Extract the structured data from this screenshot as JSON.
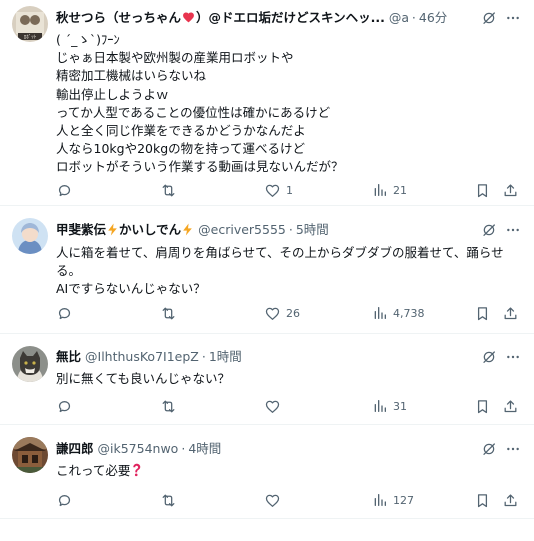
{
  "colors": {
    "text_primary": "#0f1419",
    "text_secondary": "#536471",
    "divider": "#eff3f4",
    "background": "#ffffff"
  },
  "tweets": [
    {
      "display_name": "秋せつら（せっちゃん",
      "display_name_after": "）@ドエロ垢だけどスキンヘッ...",
      "name_emoji": "heart",
      "handle": "@a",
      "time": "46分",
      "avatar_badge": "ﾛﾎﾞｯﾄ",
      "header_icon": "grok-icon",
      "more_icon": "more-icon",
      "body_lines": [
        "( ´_ゝ`)ﾌｰﾝ",
        "じゃぁ日本製や欧州製の産業用ロボットや",
        "精密加工機械はいらないね",
        "輸出停止しようよｗ",
        "ってか人型であることの優位性は確かにあるけど",
        "人と全く同じ作業をできるかどうかなんだよ",
        "人なら10kgや20kgの物を持って運べるけど",
        "ロボットがそういう作業する動画は見ないんだが？"
      ],
      "actions": {
        "reply": "",
        "repost": "",
        "like": "1",
        "views": "21"
      }
    },
    {
      "display_name": "甲斐紫伝",
      "display_name_mid": "かいしでん",
      "name_emoji": "lightning",
      "handle": "@ecriver5555",
      "time": "5時間",
      "header_icon": "grok-icon",
      "more_icon": "more-icon",
      "body_lines": [
        "人に箱を着せて、肩周りを角ばらせて、その上からダブダブの服着せて、踊らせる。",
        "AIですらないんじゃない？"
      ],
      "actions": {
        "reply": "",
        "repost": "",
        "like": "26",
        "views": "4,738"
      }
    },
    {
      "display_name": "無比",
      "handle": "@IlhthusKo7I1epZ",
      "time": "1時間",
      "header_icon": "grok-icon",
      "more_icon": "more-icon",
      "body_lines": [
        "別に無くても良いんじゃない？"
      ],
      "actions": {
        "reply": "",
        "repost": "",
        "like": "",
        "views": "31"
      }
    },
    {
      "display_name": "謙四郎",
      "handle": "@ik5754nwo",
      "time": "4時間",
      "header_icon": "grok-icon",
      "more_icon": "more-icon",
      "body_lines": [
        "これって必要"
      ],
      "body_emoji": "red-question-mark",
      "actions": {
        "reply": "",
        "repost": "",
        "like": "",
        "views": "127"
      }
    }
  ]
}
